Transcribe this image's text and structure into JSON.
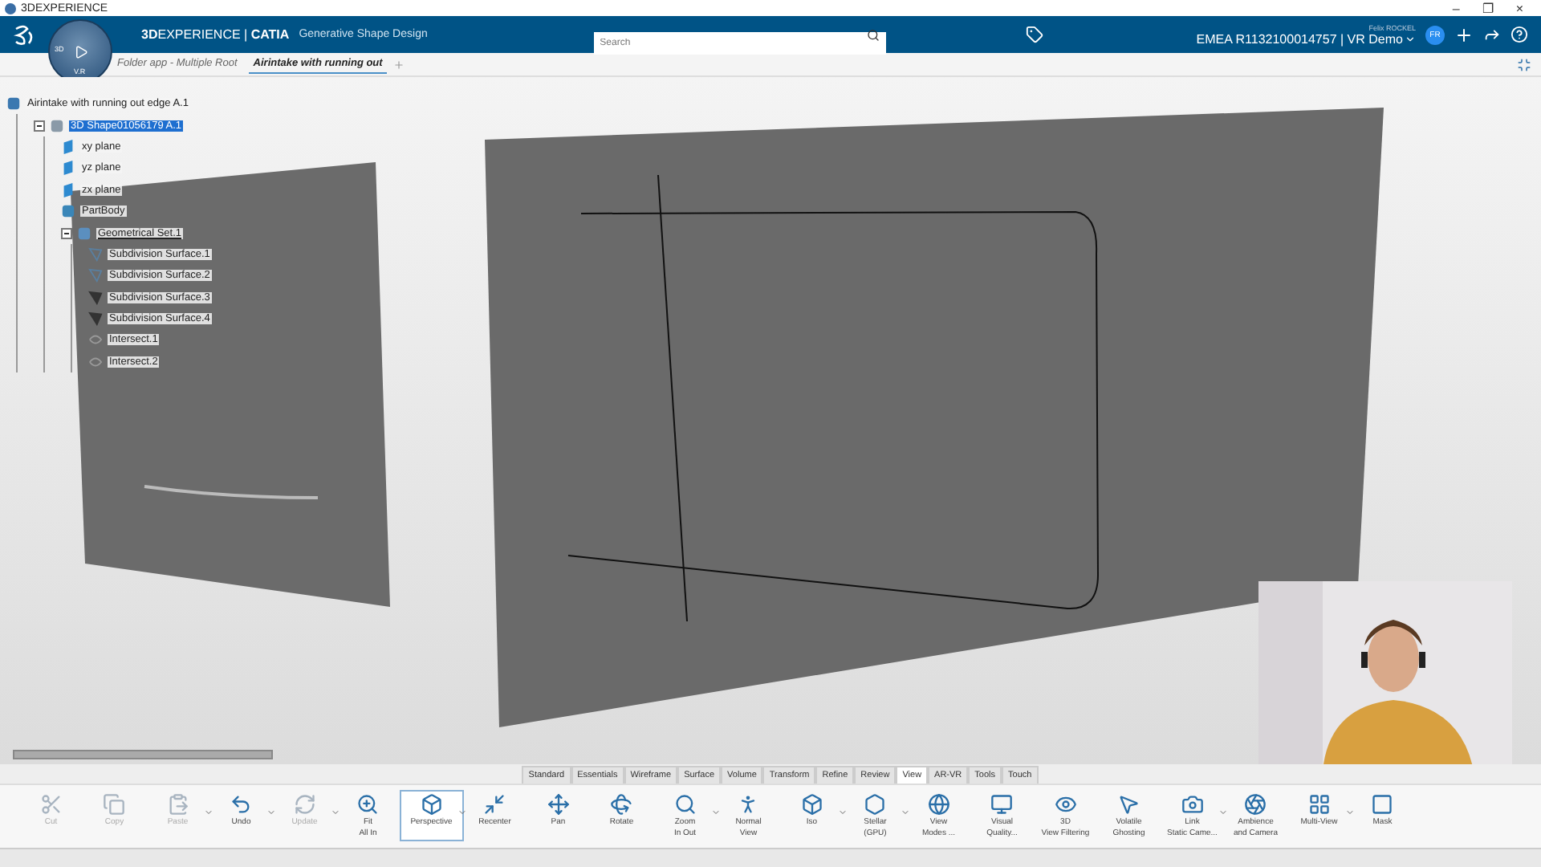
{
  "window": {
    "title": "3DEXPERIENCE",
    "controls": [
      "–",
      "❐",
      "×"
    ]
  },
  "top_bar": {
    "brand_bold": "3D",
    "brand_rest": "EXPERIENCE | ",
    "app": "CATIA",
    "app_name": "Generative Shape Design",
    "search": {
      "placeholder": "Search"
    },
    "user_name": "Felix ROCKEL",
    "tenant": "EMEA R1132100014757 | VR Demo",
    "avatar": "FR"
  },
  "compass": {
    "left": "3D",
    "bottom": "V.R"
  },
  "tabs": [
    {
      "label": "Folder app - Multiple Root",
      "selected": false
    },
    {
      "label": "Airintake with running out",
      "selected": true
    }
  ],
  "tree": {
    "label": "Airintake with running out edge A.1",
    "kind": "product",
    "selected": false,
    "children": [
      {
        "label": "3D Shape01056179 A.1",
        "kind": "shape",
        "selected": true,
        "expanded": true,
        "children": [
          {
            "label": "xy plane",
            "kind": "plane",
            "selected": false
          },
          {
            "label": "yz plane",
            "kind": "plane",
            "selected": false
          },
          {
            "label": "zx plane",
            "kind": "plane",
            "selected": false
          },
          {
            "label": "PartBody",
            "kind": "body",
            "selected": false
          },
          {
            "label": "Geometrical Set.1",
            "kind": "set",
            "selected": false,
            "expanded": true,
            "children": [
              {
                "label": "Subdivision Surface.1",
                "kind": "subdivision",
                "selected": false
              },
              {
                "label": "Subdivision Surface.2",
                "kind": "subdivision",
                "selected": false
              },
              {
                "label": "Subdivision Surface.3",
                "kind": "subdivision_solid",
                "selected": false
              },
              {
                "label": "Subdivision Surface.4",
                "kind": "subdivision_solid",
                "selected": false
              },
              {
                "label": "Intersect.1",
                "kind": "intersect",
                "selected": false
              },
              {
                "label": "Intersect.2",
                "kind": "intersect",
                "selected": false
              }
            ]
          }
        ]
      }
    ]
  },
  "toolbar_tabs": [
    {
      "label": "Standard",
      "selected": false
    },
    {
      "label": "Essentials",
      "selected": false
    },
    {
      "label": "Wireframe",
      "selected": false
    },
    {
      "label": "Surface",
      "selected": false
    },
    {
      "label": "Volume",
      "selected": false
    },
    {
      "label": "Transform",
      "selected": false
    },
    {
      "label": "Refine",
      "selected": false
    },
    {
      "label": "Review",
      "selected": false
    },
    {
      "label": "View",
      "selected": true
    },
    {
      "label": "AR-VR",
      "selected": false
    },
    {
      "label": "Tools",
      "selected": false
    },
    {
      "label": "Touch",
      "selected": false
    }
  ],
  "toolbar": [
    {
      "kind": "cut",
      "label": [
        "Cut"
      ],
      "disabled": true,
      "dropdown": false,
      "selected": false
    },
    {
      "kind": "copy",
      "label": [
        "Copy"
      ],
      "disabled": true,
      "dropdown": false,
      "selected": false
    },
    {
      "kind": "paste",
      "label": [
        "Paste"
      ],
      "disabled": true,
      "dropdown": true,
      "selected": false
    },
    {
      "kind": "undo",
      "label": [
        "Undo"
      ],
      "disabled": false,
      "dropdown": true,
      "selected": false
    },
    {
      "kind": "update",
      "label": [
        "Update"
      ],
      "disabled": true,
      "dropdown": true,
      "selected": false
    },
    {
      "kind": "fit",
      "label": [
        "Fit",
        "All In"
      ],
      "disabled": false,
      "dropdown": false,
      "selected": false
    },
    {
      "kind": "perspective",
      "label": [
        "Perspective"
      ],
      "disabled": false,
      "dropdown": true,
      "selected": true
    },
    {
      "kind": "recenter",
      "label": [
        "Recenter"
      ],
      "disabled": false,
      "dropdown": false,
      "selected": false
    },
    {
      "kind": "pan",
      "label": [
        "Pan"
      ],
      "disabled": false,
      "dropdown": false,
      "selected": false
    },
    {
      "kind": "rotate",
      "label": [
        "Rotate"
      ],
      "disabled": false,
      "dropdown": false,
      "selected": false
    },
    {
      "kind": "zoom",
      "label": [
        "Zoom",
        "In Out"
      ],
      "disabled": false,
      "dropdown": true,
      "selected": false
    },
    {
      "kind": "normal",
      "label": [
        "Normal",
        "View"
      ],
      "disabled": false,
      "dropdown": false,
      "selected": false
    },
    {
      "kind": "iso",
      "label": [
        "Iso"
      ],
      "disabled": false,
      "dropdown": true,
      "selected": false
    },
    {
      "kind": "stellar",
      "label": [
        "Stellar",
        "(GPU)"
      ],
      "disabled": false,
      "dropdown": true,
      "selected": false
    },
    {
      "kind": "modes",
      "label": [
        "View",
        "Modes ..."
      ],
      "disabled": false,
      "dropdown": false,
      "selected": false
    },
    {
      "kind": "quality",
      "label": [
        "Visual",
        "Quality..."
      ],
      "disabled": false,
      "dropdown": false,
      "selected": false
    },
    {
      "kind": "filtering",
      "label": [
        "3D",
        "View Filtering"
      ],
      "disabled": false,
      "dropdown": false,
      "selected": false
    },
    {
      "kind": "ghosting",
      "label": [
        "Volatile",
        "Ghosting"
      ],
      "disabled": false,
      "dropdown": false,
      "selected": false
    },
    {
      "kind": "camera",
      "label": [
        "Link",
        "Static Came..."
      ],
      "disabled": false,
      "dropdown": true,
      "selected": false
    },
    {
      "kind": "ambience",
      "label": [
        "Ambience",
        "and Camera"
      ],
      "disabled": false,
      "dropdown": false,
      "selected": false
    },
    {
      "kind": "multiview",
      "label": [
        "Multi-View"
      ],
      "disabled": false,
      "dropdown": true,
      "selected": false
    },
    {
      "kind": "mask",
      "label": [
        "Mask"
      ],
      "disabled": false,
      "dropdown": false,
      "selected": false
    }
  ]
}
